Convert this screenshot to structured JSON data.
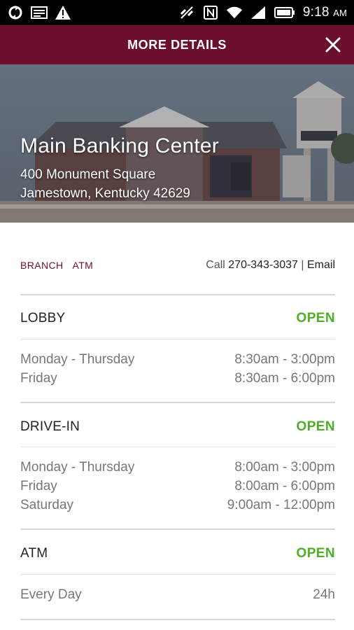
{
  "status_bar": {
    "time": "9:18",
    "ampm": "AM"
  },
  "header": {
    "title": "MORE DETAILS",
    "close_icon": "close-icon"
  },
  "hero": {
    "name": "Main Banking Center",
    "address_line1": "400 Monument Square",
    "address_line2": "Jamestown, Kentucky 42629"
  },
  "tabs": [
    "BRANCH",
    "ATM"
  ],
  "contact": {
    "call_label": "Call",
    "phone": "270-343-3037",
    "separator": "|",
    "email_label": "Email"
  },
  "sections": [
    {
      "title": "LOBBY",
      "status": "OPEN",
      "hours": [
        {
          "days": "Monday - Thursday",
          "time": "8:30am - 3:00pm"
        },
        {
          "days": "Friday",
          "time": "8:30am - 6:00pm"
        }
      ]
    },
    {
      "title": "DRIVE-IN",
      "status": "OPEN",
      "hours": [
        {
          "days": "Monday - Thursday",
          "time": "8:00am - 3:00pm"
        },
        {
          "days": "Friday",
          "time": "8:00am - 6:00pm"
        },
        {
          "days": "Saturday",
          "time": "9:00am - 12:00pm"
        }
      ]
    },
    {
      "title": "ATM",
      "status": "OPEN",
      "hours": [
        {
          "days": "Every Day",
          "time": "24h"
        }
      ]
    }
  ],
  "colors": {
    "brand": "#6c0f2c",
    "open_status": "#4caf26"
  }
}
